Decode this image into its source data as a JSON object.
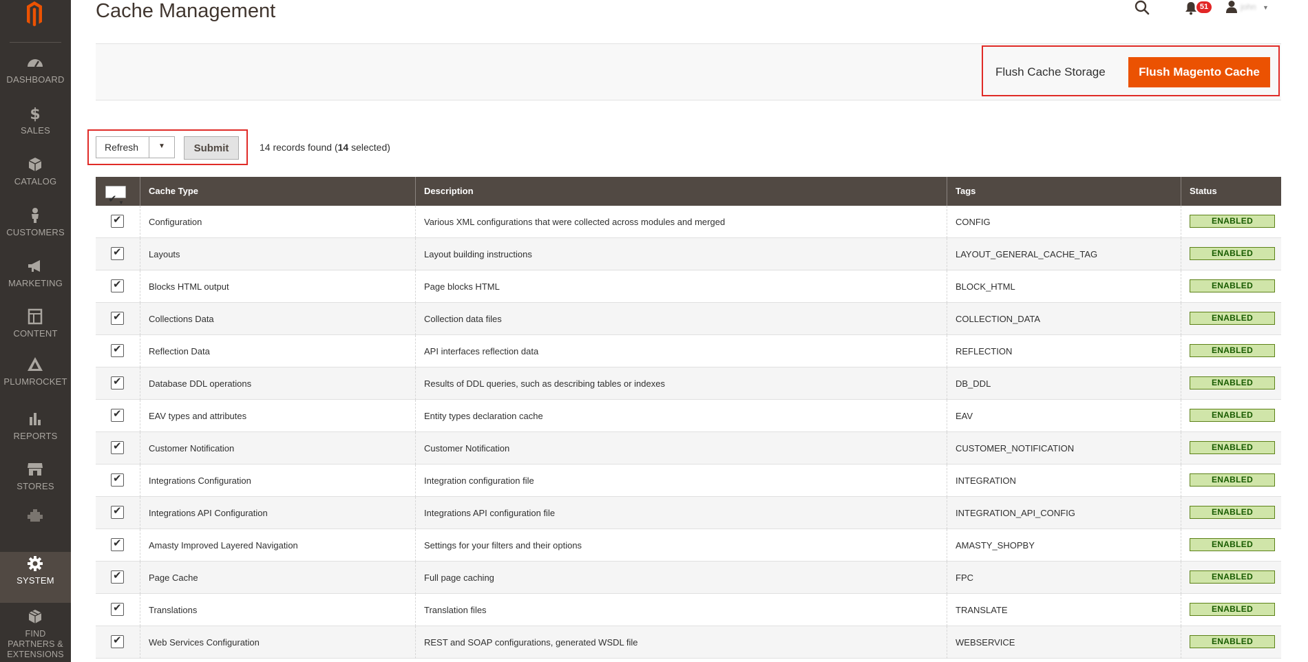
{
  "page": {
    "title": "Cache Management"
  },
  "colors": {
    "accent": "#eb5202",
    "sidebar_bg": "#373330",
    "header_bg": "#514943",
    "status_bg": "#d0e5a9"
  },
  "sidebar": {
    "logo": "magento-logo",
    "items": [
      {
        "label": "DASHBOARD",
        "icon": "dashboard-icon",
        "active": false
      },
      {
        "label": "SALES",
        "icon": "dollar-icon",
        "active": false
      },
      {
        "label": "CATALOG",
        "icon": "box-icon",
        "active": false
      },
      {
        "label": "CUSTOMERS",
        "icon": "person-icon",
        "active": false
      },
      {
        "label": "MARKETING",
        "icon": "megaphone-icon",
        "active": false
      },
      {
        "label": "CONTENT",
        "icon": "layout-icon",
        "active": false
      },
      {
        "label": "PLUMROCKET",
        "icon": "plumrocket-icon",
        "active": false
      },
      {
        "label": "REPORTS",
        "icon": "bar-chart-icon",
        "active": false
      },
      {
        "label": "STORES",
        "icon": "store-icon",
        "active": false
      },
      {
        "label": "",
        "icon": "puzzle-icon",
        "active": false
      },
      {
        "label": "SYSTEM",
        "icon": "gear-icon",
        "active": true
      },
      {
        "label": "FIND PARTNERS & EXTENSIONS",
        "icon": "cubes-icon",
        "active": false
      }
    ]
  },
  "header": {
    "notifications_count": "51",
    "user_name": "john"
  },
  "actions": {
    "flush_storage_label": "Flush Cache Storage",
    "flush_magento_label": "Flush Magento Cache"
  },
  "mass_action": {
    "selected_value": "Refresh",
    "submit_label": "Submit",
    "records_prefix": "14 records found (",
    "selected_count": "14",
    "records_suffix": " selected)"
  },
  "grid": {
    "columns": [
      "Cache Type",
      "Description",
      "Tags",
      "Status"
    ],
    "rows": [
      {
        "type": "Configuration",
        "description": "Various XML configurations that were collected across modules and merged",
        "tags": "CONFIG",
        "status": "ENABLED",
        "checked": true
      },
      {
        "type": "Layouts",
        "description": "Layout building instructions",
        "tags": "LAYOUT_GENERAL_CACHE_TAG",
        "status": "ENABLED",
        "checked": true
      },
      {
        "type": "Blocks HTML output",
        "description": "Page blocks HTML",
        "tags": "BLOCK_HTML",
        "status": "ENABLED",
        "checked": true
      },
      {
        "type": "Collections Data",
        "description": "Collection data files",
        "tags": "COLLECTION_DATA",
        "status": "ENABLED",
        "checked": true
      },
      {
        "type": "Reflection Data",
        "description": "API interfaces reflection data",
        "tags": "REFLECTION",
        "status": "ENABLED",
        "checked": true
      },
      {
        "type": "Database DDL operations",
        "description": "Results of DDL queries, such as describing tables or indexes",
        "tags": "DB_DDL",
        "status": "ENABLED",
        "checked": true
      },
      {
        "type": "EAV types and attributes",
        "description": "Entity types declaration cache",
        "tags": "EAV",
        "status": "ENABLED",
        "checked": true
      },
      {
        "type": "Customer Notification",
        "description": "Customer Notification",
        "tags": "CUSTOMER_NOTIFICATION",
        "status": "ENABLED",
        "checked": true
      },
      {
        "type": "Integrations Configuration",
        "description": "Integration configuration file",
        "tags": "INTEGRATION",
        "status": "ENABLED",
        "checked": true
      },
      {
        "type": "Integrations API Configuration",
        "description": "Integrations API configuration file",
        "tags": "INTEGRATION_API_CONFIG",
        "status": "ENABLED",
        "checked": true
      },
      {
        "type": "Amasty Improved Layered Navigation",
        "description": "Settings for your filters and their options",
        "tags": "AMASTY_SHOPBY",
        "status": "ENABLED",
        "checked": true
      },
      {
        "type": "Page Cache",
        "description": "Full page caching",
        "tags": "FPC",
        "status": "ENABLED",
        "checked": true
      },
      {
        "type": "Translations",
        "description": "Translation files",
        "tags": "TRANSLATE",
        "status": "ENABLED",
        "checked": true
      },
      {
        "type": "Web Services Configuration",
        "description": "REST and SOAP configurations, generated WSDL file",
        "tags": "WEBSERVICE",
        "status": "ENABLED",
        "checked": true
      }
    ]
  }
}
